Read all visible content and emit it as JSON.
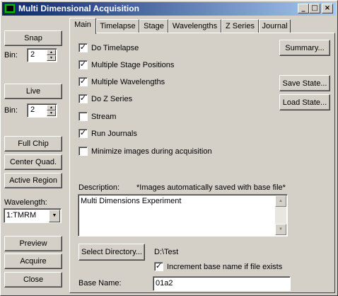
{
  "window": {
    "title": "Multi Dimensional Acquisition",
    "minimize_glyph": "_",
    "maximize_glyph": "□",
    "close_glyph": "×"
  },
  "left": {
    "snap_label": "Snap",
    "bin1_label": "Bin:",
    "bin1_value": "2",
    "live_label": "Live",
    "bin2_label": "Bin:",
    "bin2_value": "2",
    "full_chip_label": "Full Chip",
    "center_quad_label": "Center Quad.",
    "active_region_label": "Active Region",
    "wavelength_label": "Wavelength:",
    "wavelength_value": "1:TMRM",
    "preview_label": "Preview",
    "acquire_label": "Acquire",
    "close_label": "Close"
  },
  "tabs": [
    {
      "label": "Main",
      "active": true
    },
    {
      "label": "Timelapse",
      "active": false
    },
    {
      "label": "Stage",
      "active": false
    },
    {
      "label": "Wavelengths",
      "active": false
    },
    {
      "label": "Z Series",
      "active": false
    },
    {
      "label": "Journal",
      "active": false
    }
  ],
  "main": {
    "options": [
      {
        "label": "Do Timelapse",
        "checked": true
      },
      {
        "label": "Multiple Stage Positions",
        "checked": true
      },
      {
        "label": "Multiple Wavelengths",
        "checked": true
      },
      {
        "label": "Do Z Series",
        "checked": true
      },
      {
        "label": "Stream",
        "checked": false
      },
      {
        "label": "Run Journals",
        "checked": true
      },
      {
        "label": "Minimize images during acquisition",
        "checked": false
      }
    ],
    "summary_label": "Summary...",
    "save_state_label": "Save State...",
    "load_state_label": "Load State...",
    "description_label": "Description:",
    "description_note": "*Images automatically saved with base file*",
    "description_value": "Multi Dimensions Experiment",
    "select_directory_label": "Select Directory...",
    "directory_value": "D:\\Test",
    "increment_label": "Increment base name if file exists",
    "increment_checked": true,
    "base_name_label": "Base Name:",
    "base_name_value": "01a2"
  }
}
